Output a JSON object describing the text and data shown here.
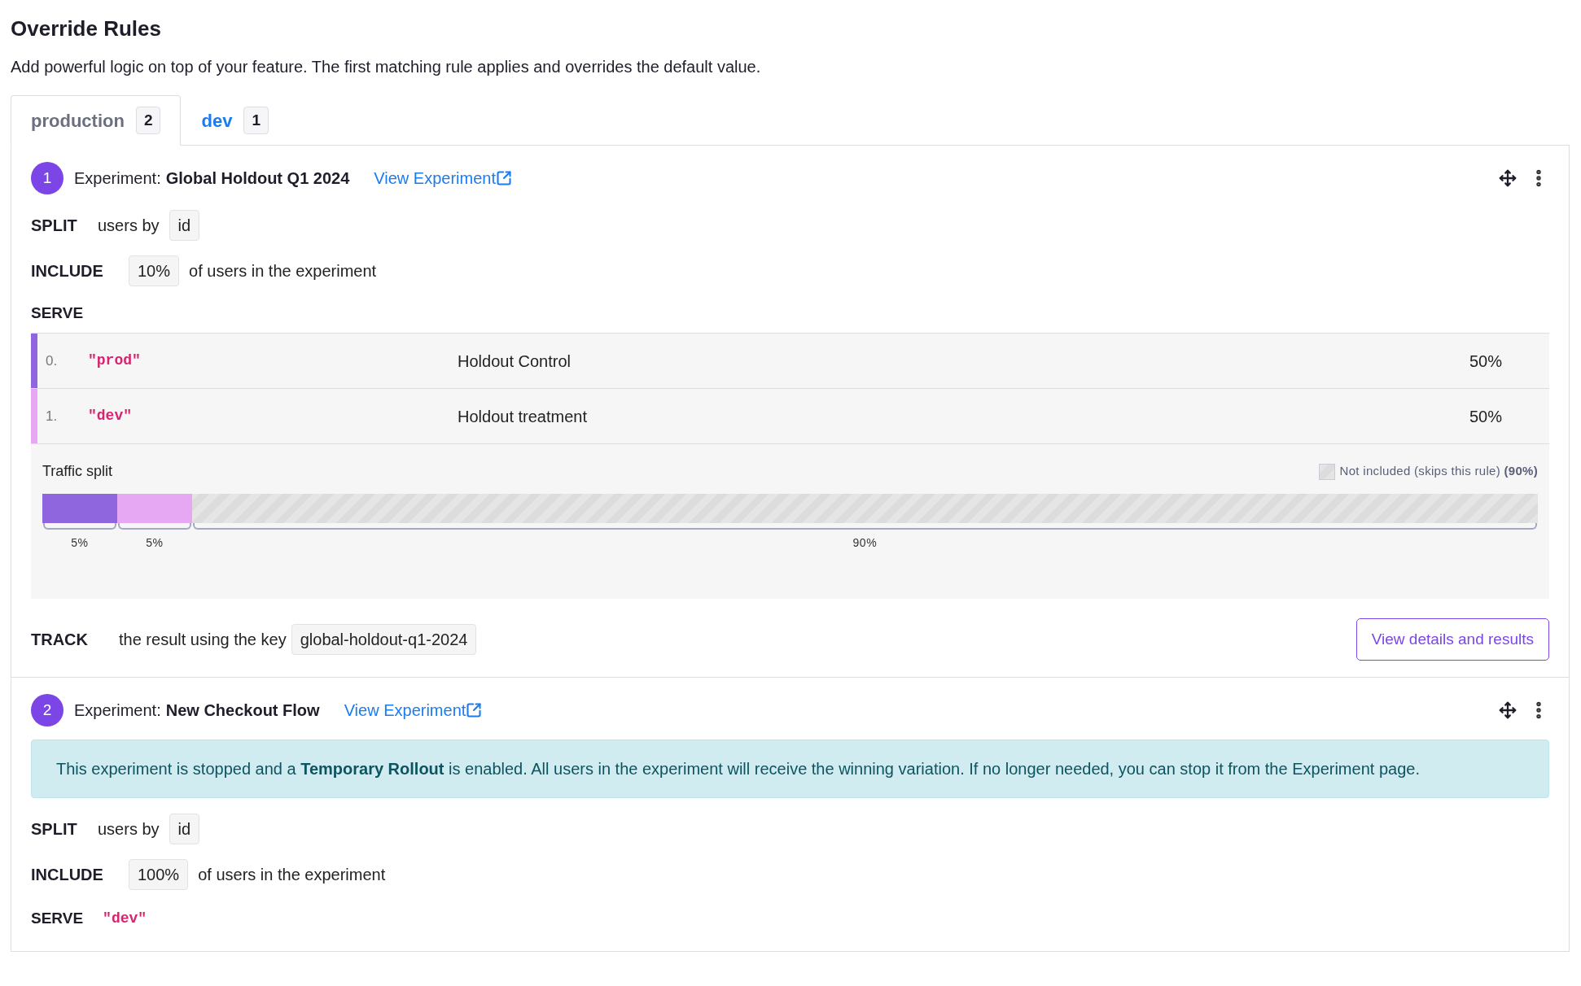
{
  "title": "Override Rules",
  "description": "Add powerful logic on top of your feature. The first matching rule applies and overrides the default value.",
  "tabs": [
    {
      "label": "production",
      "count": "2",
      "selected": true
    },
    {
      "label": "dev",
      "count": "1",
      "selected": false
    }
  ],
  "rules": [
    {
      "number": "1",
      "experiment_label": "Experiment:",
      "experiment_name": "Global Holdout Q1 2024",
      "link": "View Experiment",
      "split": {
        "keyword": "SPLIT",
        "text": "users by",
        "attribute": "id"
      },
      "include": {
        "keyword": "INCLUDE",
        "percent": "10%",
        "text": "of users in the experiment"
      },
      "serve": {
        "keyword": "SERVE",
        "kind": "variations",
        "variations": [
          {
            "index": "0.",
            "value": "\"prod\"",
            "name": "Holdout Control",
            "percent": "50%",
            "color": "#9066df"
          },
          {
            "index": "1.",
            "value": "\"dev\"",
            "name": "Holdout treatment",
            "percent": "50%",
            "color": "#e6a7f3"
          }
        ],
        "traffic": {
          "label": "Traffic split",
          "legend": "Not included (skips this rule)",
          "legend_percent": "(90%)",
          "segments": [
            {
              "kind": "variation",
              "level": 0.05,
              "label": "5%",
              "color": "#9066df"
            },
            {
              "kind": "variation",
              "level": 0.05,
              "label": "5%",
              "color": "#e6a7f3"
            },
            {
              "kind": "excluded",
              "level": 0.9,
              "label": "90%"
            }
          ]
        }
      },
      "track": {
        "keyword": "TRACK",
        "text": "the result using the key",
        "key": "global-holdout-q1-2024"
      },
      "button": "View details and results"
    },
    {
      "number": "2",
      "experiment_label": "Experiment:",
      "experiment_name": "New Checkout Flow",
      "link": "View Experiment",
      "alert": "This experiment is stopped and a **Temporary Rollout** is enabled. All users in the experiment will receive the winning variation. If no longer needed, you can stop it from the Experiment page.",
      "split": {
        "keyword": "SPLIT",
        "text": "users by",
        "attribute": "id"
      },
      "include": {
        "keyword": "INCLUDE",
        "percent": "100%",
        "text": "of users in the experiment"
      },
      "serve": {
        "keyword": "SERVE",
        "kind": "single",
        "value": "\"dev\""
      }
    }
  ]
}
